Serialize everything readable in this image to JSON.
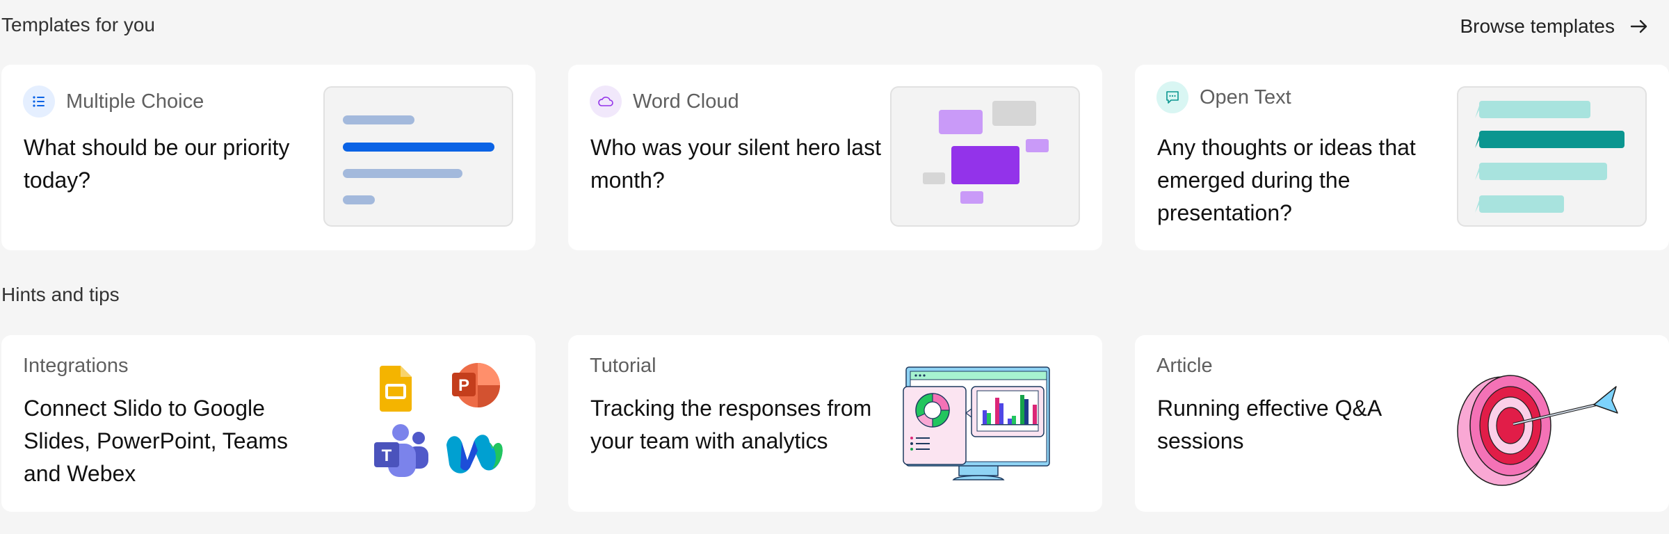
{
  "templates": {
    "title": "Templates for you",
    "browse_label": "Browse templates",
    "cards": [
      {
        "type_label": "Multiple Choice",
        "question": "What should be our priority today?"
      },
      {
        "type_label": "Word Cloud",
        "question": "Who was your silent hero last month?"
      },
      {
        "type_label": "Open Text",
        "question": "Any thoughts or ideas that emerged during the presentation?"
      }
    ]
  },
  "tips": {
    "title": "Hints and tips",
    "cards": [
      {
        "category": "Integrations",
        "text": "Connect Slido to Google Slides, PowerPoint, Teams and Webex"
      },
      {
        "category": "Tutorial",
        "text": "Tracking the responses from your team with analytics"
      },
      {
        "category": "Article",
        "text": "Running effective Q&A sessions"
      }
    ]
  },
  "icons": {
    "browse": "arrow-right-icon",
    "multiple_choice": "list-icon",
    "word_cloud": "cloud-icon",
    "open_text": "chat-bubble-icon",
    "integrations": [
      "google-slides-icon",
      "powerpoint-icon",
      "teams-icon",
      "webex-icon"
    ],
    "tutorial": "analytics-monitor-illustration",
    "article": "target-arrow-illustration"
  },
  "colors": {
    "background": "#f5f5f5",
    "card": "#ffffff",
    "mc_accent": "#0b63e5",
    "wordcloud_accent": "#9333ea",
    "opentext_accent": "#0b9690"
  }
}
